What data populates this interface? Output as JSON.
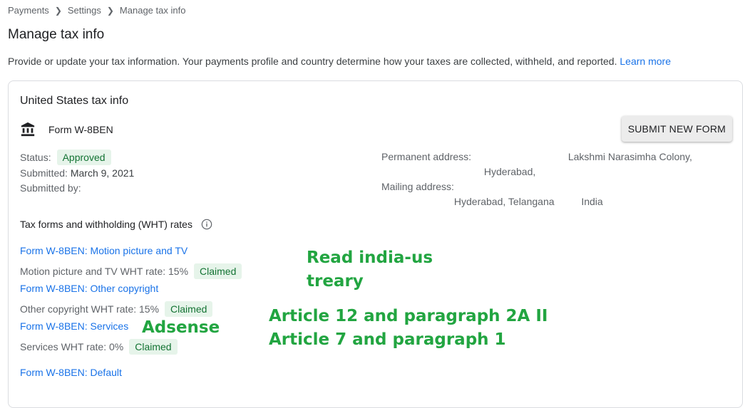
{
  "breadcrumb": [
    "Payments",
    "Settings",
    "Manage tax info"
  ],
  "page_title": "Manage tax info",
  "intro": {
    "text": "Provide or update your tax information. Your payments profile and country determine how your taxes are collected, withheld, and reported.",
    "link": "Learn more"
  },
  "card": {
    "title": "United States tax info",
    "form_name": "Form W-8BEN",
    "submit_label": "SUBMIT NEW FORM",
    "status_label": "Status:",
    "status_value": "Approved",
    "submitted_label": "Submitted:",
    "submitted_value": "March 9, 2021",
    "submitted_by_label": "Submitted by:",
    "permanent_label": "Permanent address:",
    "permanent_line1": "Lakshmi Narasimha Colony,",
    "permanent_line2": "Hyderabad,",
    "mailing_label": "Mailing address:",
    "mailing_line2a": "Hyderabad, Telangana",
    "mailing_line2b": "India"
  },
  "wht": {
    "section_title": "Tax forms and withholding (WHT) rates",
    "items": [
      {
        "link": "Form W-8BEN: Motion picture and TV",
        "rate": "Motion picture and TV WHT rate: 15%",
        "chip": "Claimed"
      },
      {
        "link": "Form W-8BEN: Other copyright",
        "rate": "Other copyright WHT rate: 15%",
        "chip": "Claimed"
      },
      {
        "link": "Form W-8BEN: Services",
        "rate": "Services WHT rate: 0%",
        "chip": "Claimed"
      },
      {
        "link": "Form W-8BEN: Default"
      }
    ]
  },
  "annotations": {
    "read_line1": "Read india-us",
    "read_line2": "treary",
    "adsense": "Adsense",
    "article_line1": "Article 12 and paragraph 2A II",
    "article_line2": "Article 7 and paragraph 1"
  },
  "colors": {
    "link": "#1a73e8",
    "chip_bg": "#e6f4ea",
    "chip_text": "#137333",
    "annotation": "#22a541"
  },
  "icons": [
    "chevron-right-icon",
    "bank-icon",
    "info-icon"
  ]
}
